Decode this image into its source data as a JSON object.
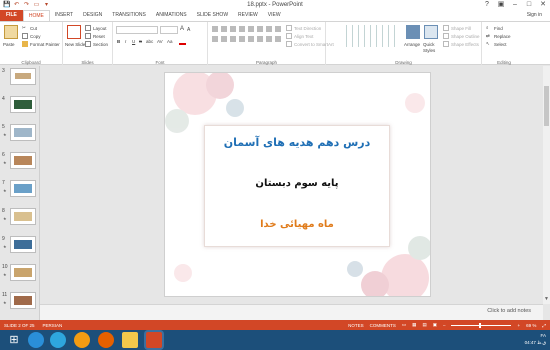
{
  "window": {
    "title": "18.pptx - PowerPoint"
  },
  "quick_access": [
    {
      "icon": "save-icon"
    },
    {
      "icon": "undo-icon"
    },
    {
      "icon": "redo-icon"
    },
    {
      "icon": "start-slideshow-icon"
    },
    {
      "icon": "customize-icon"
    }
  ],
  "window_controls": [
    {
      "icon": "help-icon",
      "glyph": "?"
    },
    {
      "icon": "ribbon-display-icon",
      "glyph": "▣"
    },
    {
      "icon": "minimize-icon",
      "glyph": "–"
    },
    {
      "icon": "maximize-icon",
      "glyph": "□"
    },
    {
      "icon": "close-icon",
      "glyph": "✕"
    }
  ],
  "tabs": [
    "FILE",
    "HOME",
    "INSERT",
    "DESIGN",
    "TRANSITIONS",
    "ANIMATIONS",
    "SLIDE SHOW",
    "REVIEW",
    "VIEW"
  ],
  "active_tab": "HOME",
  "sign_in": "Sign in",
  "ribbon": {
    "clipboard": {
      "label": "Clipboard",
      "paste": "Paste",
      "cut": "Cut",
      "copy": "Copy",
      "format_painter": "Format Painter"
    },
    "slides": {
      "label": "Slides",
      "new_slide": "New Slide",
      "layout": "Layout",
      "reset": "Reset",
      "section": "Section"
    },
    "font": {
      "label": "Font",
      "bold": "B",
      "italic": "I",
      "underline": "U",
      "strike": "S",
      "shadow": "abc",
      "spacing": "AV",
      "case": "Aa",
      "grow": "A",
      "shrink": "A"
    },
    "paragraph": {
      "label": "Paragraph",
      "text_direction": "Text Direction",
      "align_text": "Align Text",
      "smartart": "Convert to SmartArt"
    },
    "drawing": {
      "label": "Drawing",
      "arrange": "Arrange",
      "quick_styles": "Quick Styles",
      "shape_fill": "Shape Fill",
      "shape_outline": "Shape Outline",
      "shape_effects": "Shape Effects"
    },
    "editing": {
      "label": "Editing",
      "find": "Find",
      "replace": "Replace",
      "select": "Select"
    }
  },
  "thumbnails": [
    {
      "num": "3",
      "color": "#c8a97e"
    },
    {
      "num": "4",
      "color": "#2f5e3b"
    },
    {
      "num": "5",
      "color": "#9fb6c9"
    },
    {
      "num": "6",
      "color": "#b8865a"
    },
    {
      "num": "7",
      "color": "#6aa0c8"
    },
    {
      "num": "8",
      "color": "#d9c08f"
    },
    {
      "num": "9",
      "color": "#3e6e99"
    },
    {
      "num": "10",
      "color": "#c9a46c"
    },
    {
      "num": "11",
      "color": "#a06a4a"
    }
  ],
  "slide": {
    "title": "درس دهم هدیه های آسمان",
    "subtitle": "پایه سوم دبستان",
    "teacher": "ماه مهیائی خدا"
  },
  "notes_placeholder": "Click to add notes",
  "status": {
    "slide_info": "SLIDE 2 OF 25",
    "language": "PERSIAN",
    "notes": "NOTES",
    "comments": "COMMENTS",
    "zoom": "69 %"
  },
  "taskbar": {
    "apps": [
      {
        "icon": "start-icon",
        "color": "#1c4f7a"
      },
      {
        "icon": "ie-icon",
        "color": "#2a8fd8"
      },
      {
        "icon": "telegram-icon",
        "color": "#2ea6de"
      },
      {
        "icon": "media-player-icon",
        "color": "#f39c12"
      },
      {
        "icon": "firefox-icon",
        "color": "#e66000"
      },
      {
        "icon": "file-explorer-icon",
        "color": "#f2c94c"
      },
      {
        "icon": "powerpoint-icon",
        "color": "#d24726"
      }
    ],
    "lang": "FA",
    "time": "04:47 ق.ظ"
  }
}
